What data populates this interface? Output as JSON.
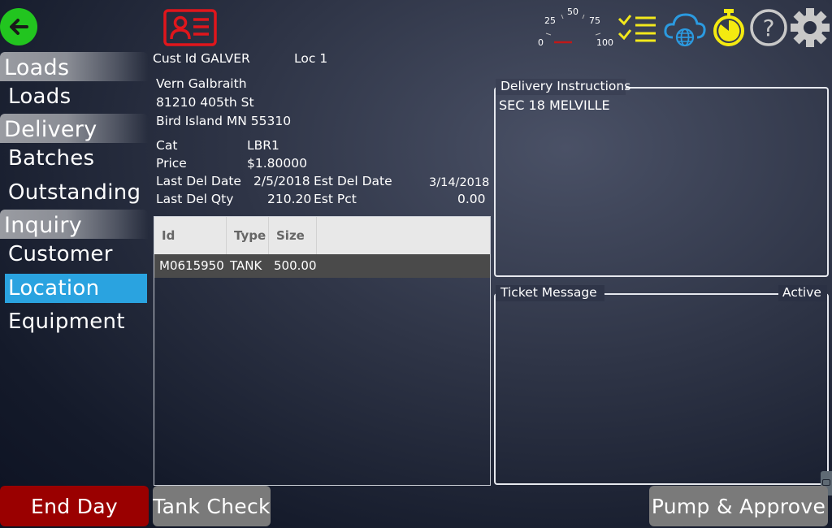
{
  "header": {
    "back_icon": "arrow-left-icon",
    "card_icon": "customer-card-icon",
    "toolbar": {
      "gauge": {
        "icon": "gauge-icon",
        "ticks": [
          "0",
          "25",
          "50",
          "75",
          "100"
        ]
      },
      "icons": [
        "checklist-icon",
        "cloud-globe-icon",
        "stopwatch-icon",
        "help-icon",
        "gear-icon"
      ]
    }
  },
  "sidebar": {
    "sections": [
      {
        "title": "Loads",
        "items": [
          {
            "label": "Loads",
            "active": false
          }
        ]
      },
      {
        "title": "Delivery",
        "items": [
          {
            "label": "Batches",
            "active": false
          },
          {
            "label": "Outstanding",
            "active": false
          }
        ]
      },
      {
        "title": "Inquiry",
        "items": [
          {
            "label": "Customer",
            "active": false
          },
          {
            "label": "Location",
            "active": true
          },
          {
            "label": "Equipment",
            "active": false
          }
        ]
      }
    ]
  },
  "customer": {
    "cust_id_label": "Cust Id",
    "cust_id": "GALVER",
    "loc_label": "Loc",
    "loc": "1",
    "name": "Vern Galbraith",
    "address": "81210 405th St",
    "city": "Bird Island",
    "state": "MN",
    "zip": "55310"
  },
  "details": {
    "cat_label": "Cat",
    "cat": "LBR1",
    "price_label": "Price",
    "price": "$1.80000",
    "last_del_date_label": "Last Del Date",
    "last_del_date": "2/5/2018",
    "est_del_date_label": "Est Del Date",
    "est_del_date": "3/14/2018",
    "last_del_qty_label": "Last Del Qty",
    "last_del_qty": "210.20",
    "est_pct_label": "Est Pct",
    "est_pct": "0.00"
  },
  "equipment_table": {
    "columns": [
      "Id",
      "Type",
      "Size"
    ],
    "rows": [
      [
        "M0615950",
        "TANK",
        "500.00"
      ]
    ]
  },
  "delivery_instructions": {
    "legend": "Delivery Instructions",
    "text": "SEC 18 MELVILLE"
  },
  "ticket_message": {
    "legend": "Ticket Message",
    "status": "Active",
    "text": ""
  },
  "footer": {
    "end_day": "End Day",
    "tank_check": "Tank Check",
    "pump_approve": "Pump & Approve"
  },
  "colors": {
    "back": "#22c51f",
    "card": "#e0161c",
    "active_nav": "#2aa3e0",
    "end_day": "#9a0000",
    "gray_button": "#7a7a7a",
    "checklist": "#f2e81c",
    "cloud": "#2b9ae0",
    "stopwatch": "#f4ea10",
    "help_gear": "#c8c8c8"
  }
}
